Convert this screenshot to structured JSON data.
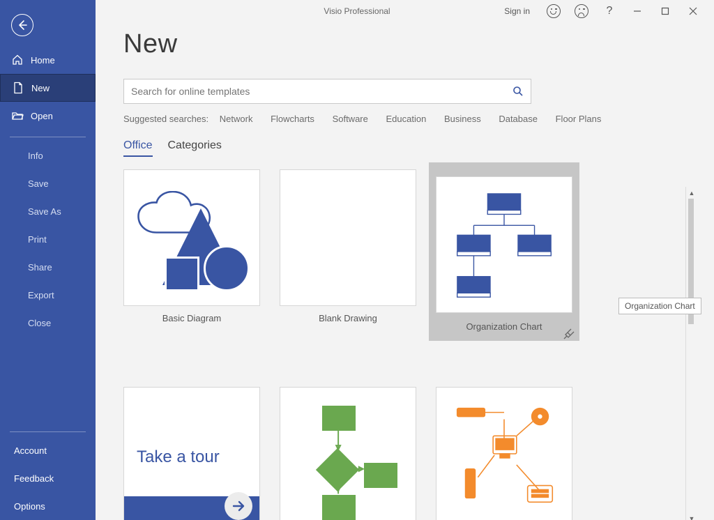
{
  "app_title": "Visio Professional",
  "titlebar": {
    "sign_in": "Sign in"
  },
  "sidebar": {
    "nav": [
      {
        "label": "Home"
      },
      {
        "label": "New"
      },
      {
        "label": "Open"
      }
    ],
    "file_menu": [
      {
        "label": "Info"
      },
      {
        "label": "Save"
      },
      {
        "label": "Save As"
      },
      {
        "label": "Print"
      },
      {
        "label": "Share"
      },
      {
        "label": "Export"
      },
      {
        "label": "Close"
      }
    ],
    "bottom": [
      {
        "label": "Account"
      },
      {
        "label": "Feedback"
      },
      {
        "label": "Options"
      }
    ]
  },
  "page": {
    "title": "New",
    "search_placeholder": "Search for online templates",
    "suggested_label": "Suggested searches:",
    "suggested": [
      "Network",
      "Flowcharts",
      "Software",
      "Education",
      "Business",
      "Database",
      "Floor Plans"
    ],
    "tabs": [
      "Office",
      "Categories"
    ],
    "active_tab": "Office",
    "templates": [
      {
        "name": "Basic Diagram"
      },
      {
        "name": "Blank Drawing"
      },
      {
        "name": "Organization Chart",
        "hovered": true
      },
      {
        "name": "Take a tour"
      },
      {
        "name": ""
      },
      {
        "name": ""
      }
    ],
    "tooltip": "Organization Chart",
    "tour_label": "Take a tour"
  }
}
